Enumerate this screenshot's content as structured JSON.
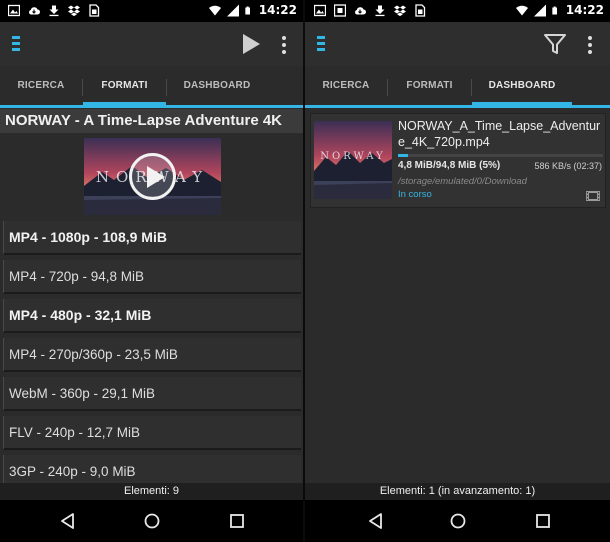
{
  "colors": {
    "accent": "#33b5e5",
    "background": "#2b2b2b",
    "card": "#323232",
    "status_bar": "#000000",
    "nav_bar": "#000000"
  },
  "left": {
    "status_bar": {
      "time": "14:22",
      "icons": [
        "image-icon",
        "cloud-download-icon",
        "download-icon",
        "dropbox-icon",
        "sim-icon",
        "wifi-icon",
        "signal-icon",
        "battery-icon"
      ]
    },
    "app_bar": {
      "icons": [
        "menu-icon",
        "play-icon",
        "overflow-menu-icon"
      ]
    },
    "tabs": [
      {
        "label": "RICERCA",
        "active": false
      },
      {
        "label": "FORMATI",
        "active": true
      },
      {
        "label": "DASHBOARD",
        "active": false
      }
    ],
    "video_title": "NORWAY - A Time-Lapse Adventure 4K",
    "thumbnail": {
      "text": "NORWAY"
    },
    "formats": [
      {
        "label": "MP4 - 1080p - 108,9 MiB",
        "bold": true
      },
      {
        "label": "MP4 - 720p - 94,8 MiB",
        "bold": false
      },
      {
        "label": "MP4 - 480p - 32,1 MiB",
        "bold": true
      },
      {
        "label": "MP4 - 270p/360p - 23,5 MiB",
        "bold": false
      },
      {
        "label": "WebM - 360p - 29,1 MiB",
        "bold": false
      },
      {
        "label": "FLV - 240p - 12,7 MiB",
        "bold": false
      },
      {
        "label": "3GP - 240p - 9,0 MiB",
        "bold": false
      }
    ],
    "footer": "Elementi: 9"
  },
  "right": {
    "status_bar": {
      "time": "14:22",
      "icons": [
        "image-icon",
        "sim-icon",
        "cloud-download-icon",
        "download-icon",
        "dropbox-icon",
        "sim-icon",
        "wifi-icon",
        "signal-icon",
        "battery-icon"
      ]
    },
    "app_bar": {
      "icons": [
        "menu-icon",
        "filter-icon",
        "overflow-menu-icon"
      ]
    },
    "tabs": [
      {
        "label": "RICERCA",
        "active": false
      },
      {
        "label": "FORMATI",
        "active": false
      },
      {
        "label": "DASHBOARD",
        "active": true
      }
    ],
    "download": {
      "filename": "NORWAY_A_Time_Lapse_Adventure_4K_720p.mp4",
      "progress_text": "4,8 MiB/94,8 MiB (5%)",
      "progress_fraction": 0.05,
      "speed": "586 KB/s (02:37)",
      "path": "/storage/emulated/0/Download",
      "status": "In corso",
      "thumbnail_text": "NORWAY"
    },
    "footer": "Elementi: 1 (in avanzamento: 1)"
  },
  "nav_bar": {
    "icons": [
      "back-icon",
      "home-icon",
      "recents-icon"
    ]
  }
}
